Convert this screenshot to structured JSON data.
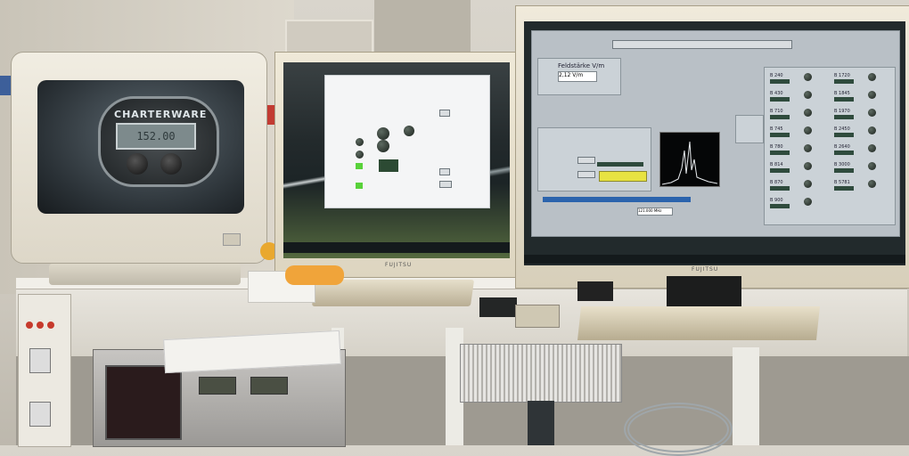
{
  "scene": {
    "description_kind": "photo of lab workstation with three monitors and test equipment"
  },
  "crt_monitor": {
    "brand_text": "CHARTERWARE",
    "readout": "152.00"
  },
  "middle_monitor": {
    "brand": "FUJITSU"
  },
  "right_monitor": {
    "brand": "FUJITSU",
    "app": {
      "field_title": "Feldstärke V/m",
      "field_value": "2,12 V/m",
      "freq_value": "121.000 MHz",
      "channels": [
        "B 240",
        "B 430",
        "B 710",
        "B 745",
        "B 780",
        "B 814",
        "B 870",
        "B 900",
        "B 1720",
        "B 1845",
        "B 1970",
        "B 2450",
        "B 2640",
        "B 3000",
        "B 5781"
      ]
    }
  },
  "colors": {
    "screen_bg": "#222a2c",
    "app_panel": "#b9c0c6",
    "progress": "#2b63ad",
    "yellow_button": "#e8e341",
    "green_led": "#58d23a"
  }
}
